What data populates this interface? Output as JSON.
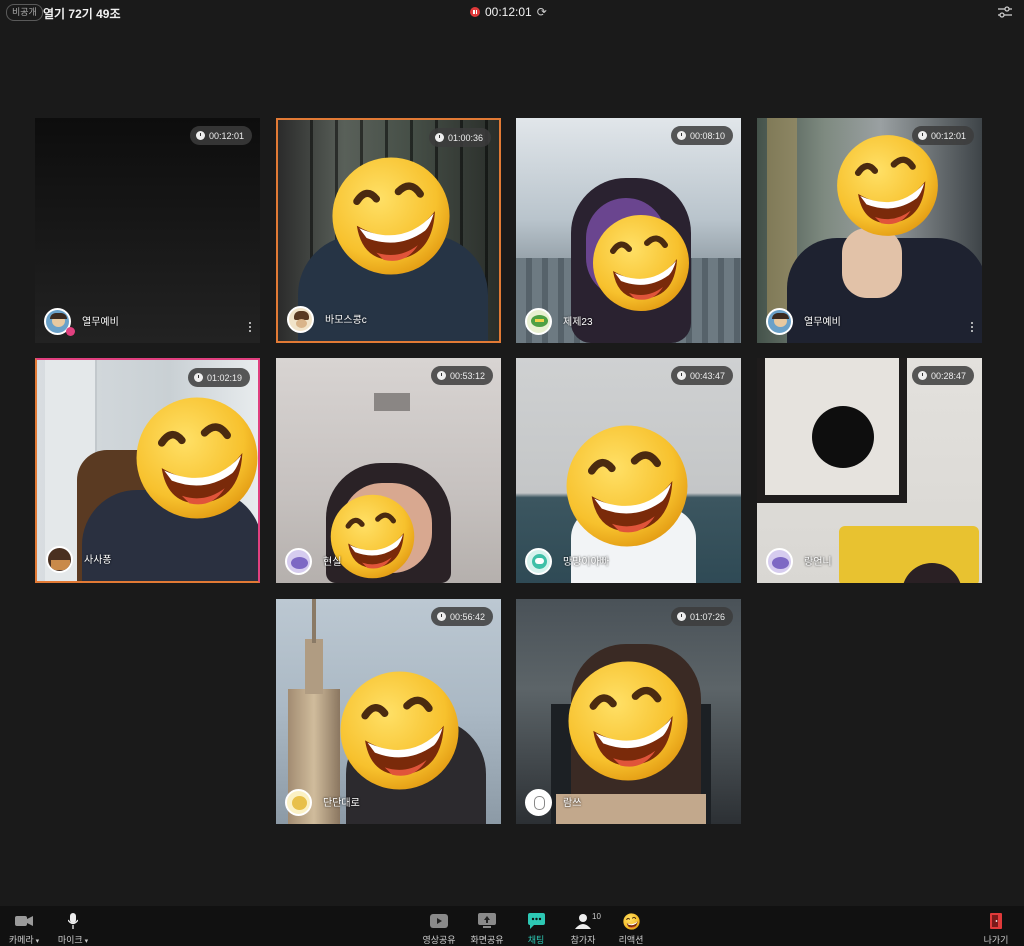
{
  "topbar": {
    "privacy_badge": "비공개",
    "room_title": "열기 72기 49조",
    "meeting_timer": "00:12:01"
  },
  "participants": [
    {
      "name": "열무예비",
      "duration": "00:12:01"
    },
    {
      "name": "바모스콩c",
      "duration": "01:00:36"
    },
    {
      "name": "제제23",
      "duration": "00:08:10"
    },
    {
      "name": "열무예비",
      "duration": "00:12:01"
    },
    {
      "name": "사사퐁",
      "duration": "01:02:19"
    },
    {
      "name": "현실",
      "duration": "00:53:12"
    },
    {
      "name": "망망이아빠",
      "duration": "00:43:47"
    },
    {
      "name": "랑언니",
      "duration": "00:28:47"
    },
    {
      "name": "단단대로",
      "duration": "00:56:42"
    },
    {
      "name": "람쓰",
      "duration": "01:07:26"
    }
  ],
  "toolbar": {
    "camera": "카메라",
    "mic": "마이크",
    "video_share": "영상공유",
    "screen_share": "화면공유",
    "chat": "채팅",
    "participants": "참가자",
    "participants_count": "10",
    "reaction": "리액션",
    "exit": "나가기"
  },
  "colors": {
    "background": "#1a1a1a",
    "speaking_pink": "#e0407f",
    "speaking_orange": "#e27a35",
    "chat_active": "#2dc8b4",
    "exit_red": "#e03a3a",
    "record_red": "#e03a3a"
  },
  "icons": [
    "clock-icon",
    "more-icon",
    "camera-icon",
    "mic-icon",
    "video-share-icon",
    "screen-share-icon",
    "chat-icon",
    "person-icon",
    "emoji-icon",
    "exit-door-icon",
    "settings-sliders-icon",
    "refresh-icon",
    "record-pause-icon"
  ]
}
